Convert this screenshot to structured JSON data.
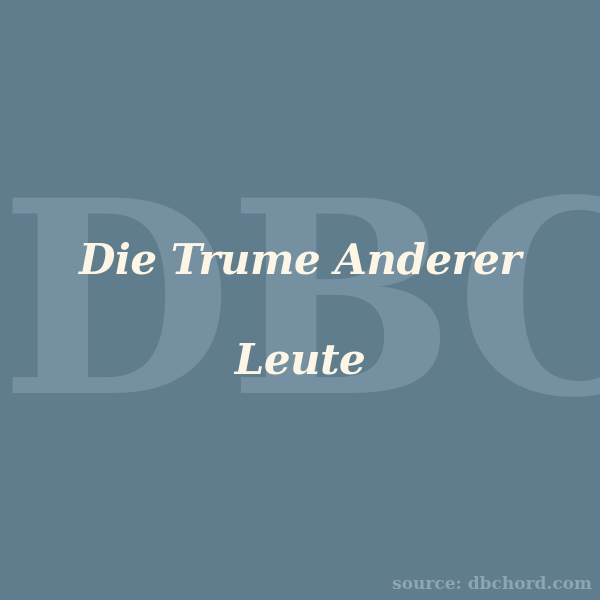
{
  "background_color": "#607d8e",
  "title_color": "#fdf6e6",
  "watermark": {
    "text": "DBC",
    "color": "#7590a1"
  },
  "title": {
    "line1": "Die Trume Anderer",
    "line2": "Leute"
  },
  "source": "source: dbchord.com"
}
